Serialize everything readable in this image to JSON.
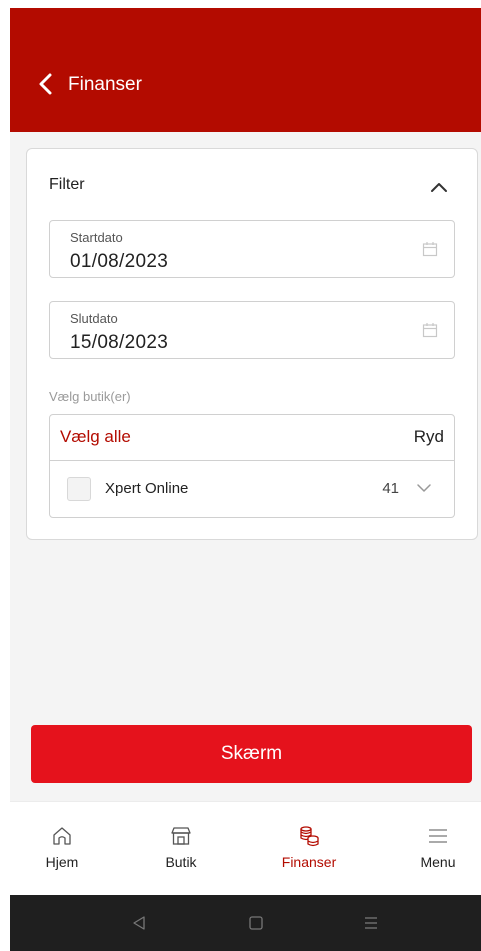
{
  "header": {
    "title": "Finanser",
    "back_icon": "chevron-left-icon"
  },
  "filter": {
    "title": "Filter",
    "collapse_icon": "chevron-up-icon",
    "start_date": {
      "label": "Startdato",
      "value": "01/08/2023",
      "icon": "calendar-icon"
    },
    "end_date": {
      "label": "Slutdato",
      "value": "15/08/2023",
      "icon": "calendar-icon"
    },
    "stores": {
      "label": "Vælg butik(er)",
      "select_all": "Vælg alle",
      "clear": "Ryd",
      "items": [
        {
          "name": "Xpert Online",
          "count": "41",
          "checked": false
        }
      ]
    }
  },
  "submit_label": "Skærm",
  "bottom_nav": [
    {
      "label": "Hjem",
      "icon": "home-icon",
      "active": false
    },
    {
      "label": "Butik",
      "icon": "store-icon",
      "active": false
    },
    {
      "label": "Finanser",
      "icon": "coins-icon",
      "active": true
    },
    {
      "label": "Menu",
      "icon": "menu-icon",
      "active": false
    }
  ],
  "system_nav": [
    "back-triangle-icon",
    "home-square-icon",
    "recents-icon"
  ],
  "colors": {
    "header": "#b30b00",
    "accent": "#b30b00",
    "button": "#e5121c",
    "background": "#f4f4f4"
  }
}
